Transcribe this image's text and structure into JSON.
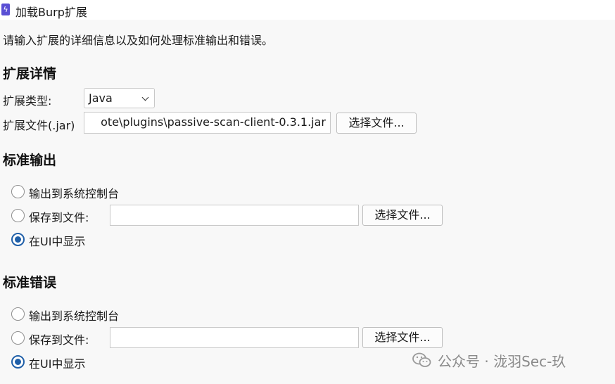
{
  "window": {
    "title": "加载Burp扩展"
  },
  "intro": "请输入扩展的详细信息以及如何处理标准输出和错误。",
  "details": {
    "heading": "扩展详情",
    "type_label": "扩展类型:",
    "type_value": "Java",
    "file_label": "扩展文件(.jar)",
    "file_value": "ote\\plugins\\passive-scan-client-0.3.1.jar",
    "choose_label": "选择文件..."
  },
  "stdout": {
    "heading": "标准输出",
    "opt_console": "输出到系统控制台",
    "opt_file": "保存到文件:",
    "file_value": "",
    "choose_label": "选择文件...",
    "opt_ui": "在UI中显示",
    "selected": "在UI中显示"
  },
  "stderr": {
    "heading": "标准错误",
    "opt_console": "输出到系统控制台",
    "opt_file": "保存到文件:",
    "file_value": "",
    "choose_label": "选择文件...",
    "opt_ui": "在UI中显示",
    "selected": "在UI中显示"
  },
  "watermark": "公众号 · 泷羽Sec-玖",
  "colors": {
    "accent": "#1f5fa8",
    "app_icon": "#5a4fd4"
  },
  "icons": {
    "app": "burp-bolt-icon",
    "watermark": "wechat-icon"
  }
}
